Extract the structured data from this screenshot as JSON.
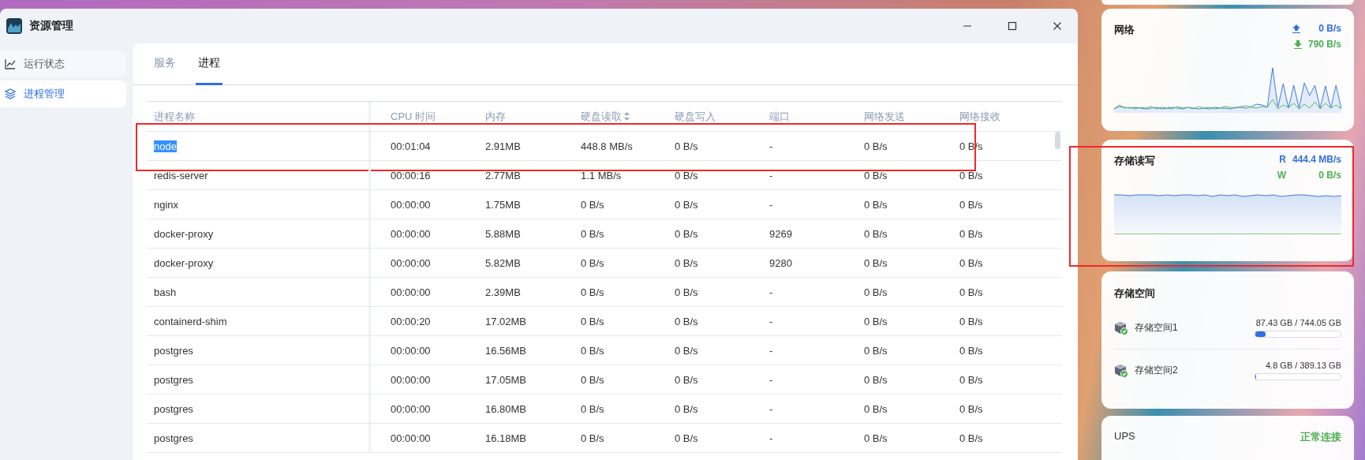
{
  "window": {
    "title": "资源管理"
  },
  "sidebar": {
    "items": [
      {
        "label": "运行状态",
        "selected": false
      },
      {
        "label": "进程管理",
        "selected": true
      }
    ]
  },
  "tabs": [
    {
      "label": "服务",
      "selected": false
    },
    {
      "label": "进程",
      "selected": true
    }
  ],
  "table": {
    "columns": [
      {
        "label": "进程名称",
        "sorted": false
      },
      {
        "label": "CPU 时间",
        "sorted": false
      },
      {
        "label": "内存",
        "sorted": false
      },
      {
        "label": "硬盘读取",
        "sorted": true
      },
      {
        "label": "硬盘写入",
        "sorted": false
      },
      {
        "label": "端口",
        "sorted": false
      },
      {
        "label": "网络发送",
        "sorted": false
      },
      {
        "label": "网络接收",
        "sorted": false
      }
    ],
    "rows": [
      {
        "cells": [
          "node",
          "00:01:04",
          "2.91MB",
          "448.8 MB/s",
          "0 B/s",
          "-",
          "0 B/s",
          "0 B/s"
        ],
        "text_selected": true,
        "highlight_box": true
      },
      {
        "cells": [
          "redis-server",
          "00:00:16",
          "2.77MB",
          "1.1 MB/s",
          "0 B/s",
          "-",
          "0 B/s",
          "0 B/s"
        ],
        "text_selected": false,
        "highlight_box": false
      },
      {
        "cells": [
          "nginx",
          "00:00:00",
          "1.75MB",
          "0 B/s",
          "0 B/s",
          "-",
          "0 B/s",
          "0 B/s"
        ],
        "text_selected": false,
        "highlight_box": false
      },
      {
        "cells": [
          "docker-proxy",
          "00:00:00",
          "5.88MB",
          "0 B/s",
          "0 B/s",
          "9269",
          "0 B/s",
          "0 B/s"
        ],
        "text_selected": false,
        "highlight_box": false
      },
      {
        "cells": [
          "docker-proxy",
          "00:00:00",
          "5.82MB",
          "0 B/s",
          "0 B/s",
          "9280",
          "0 B/s",
          "0 B/s"
        ],
        "text_selected": false,
        "highlight_box": false
      },
      {
        "cells": [
          "bash",
          "00:00:00",
          "2.39MB",
          "0 B/s",
          "0 B/s",
          "-",
          "0 B/s",
          "0 B/s"
        ],
        "text_selected": false,
        "highlight_box": false
      },
      {
        "cells": [
          "containerd-shim",
          "00:00:20",
          "17.02MB",
          "0 B/s",
          "0 B/s",
          "-",
          "0 B/s",
          "0 B/s"
        ],
        "text_selected": false,
        "highlight_box": false
      },
      {
        "cells": [
          "postgres",
          "00:00:00",
          "16.56MB",
          "0 B/s",
          "0 B/s",
          "-",
          "0 B/s",
          "0 B/s"
        ],
        "text_selected": false,
        "highlight_box": false
      },
      {
        "cells": [
          "postgres",
          "00:00:00",
          "17.05MB",
          "0 B/s",
          "0 B/s",
          "-",
          "0 B/s",
          "0 B/s"
        ],
        "text_selected": false,
        "highlight_box": false
      },
      {
        "cells": [
          "postgres",
          "00:00:00",
          "16.80MB",
          "0 B/s",
          "0 B/s",
          "-",
          "0 B/s",
          "0 B/s"
        ],
        "text_selected": false,
        "highlight_box": false
      },
      {
        "cells": [
          "postgres",
          "00:00:00",
          "16.18MB",
          "0 B/s",
          "0 B/s",
          "-",
          "0 B/s",
          "0 B/s"
        ],
        "text_selected": false,
        "highlight_box": false
      }
    ]
  },
  "network": {
    "title": "网络",
    "upload": "0 B/s",
    "download": "790 B/s"
  },
  "storage_io": {
    "title": "存储读写",
    "read_label": "R",
    "read": "444.4 MB/s",
    "write_label": "W",
    "write": "0 B/s",
    "highlight_box": true
  },
  "storage_space": {
    "title": "存储空间",
    "volumes": [
      {
        "name": "存储空间1",
        "usage": "87.43 GB / 744.05 GB",
        "level": 0.1175
      },
      {
        "name": "存储空间2",
        "usage": "4.8 GB / 389.13 GB",
        "level": 0.0123
      }
    ]
  },
  "ups": {
    "title": "UPS",
    "status": "正常连接"
  }
}
